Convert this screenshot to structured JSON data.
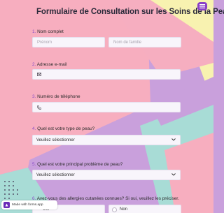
{
  "form": {
    "title": "Formulaire de Consultation sur les Soins de la Peau",
    "fields": [
      {
        "num": "1.",
        "label": "Nom complet"
      },
      {
        "num": "2.",
        "label": "Adresse e-mail"
      },
      {
        "num": "3.",
        "label": "Numéro de téléphone"
      },
      {
        "num": "4.",
        "label": "Quel est votre type de peau?"
      },
      {
        "num": "5.",
        "label": "Quel est votre principal problème de peau?"
      },
      {
        "num": "6.",
        "label": "Avez-vous des allergies cutanées connues? Si oui, veuillez les préciser."
      }
    ],
    "first_name_placeholder": "Prénom",
    "last_name_placeholder": "Nom de famille",
    "skin_type_value": "Veuillez sélectionner",
    "problem_value": "Veuillez sélectionner",
    "allergy_yes_partial": "Oui",
    "allergy_no": "Non"
  },
  "badge": {
    "text": "Made with forms.app"
  },
  "icons": {
    "top": "menu-icon",
    "email": "envelope-icon",
    "phone": "phone-icon",
    "select": "chevron-down-icon",
    "badge": "forms-app-logo-icon"
  },
  "colors": {
    "accent": "#8a4fc6",
    "background_lilac": "#c9a0dc",
    "background_pink": "#f7aebf",
    "background_yellow": "#f8f2b0",
    "background_mint": "#a8dcd6"
  }
}
